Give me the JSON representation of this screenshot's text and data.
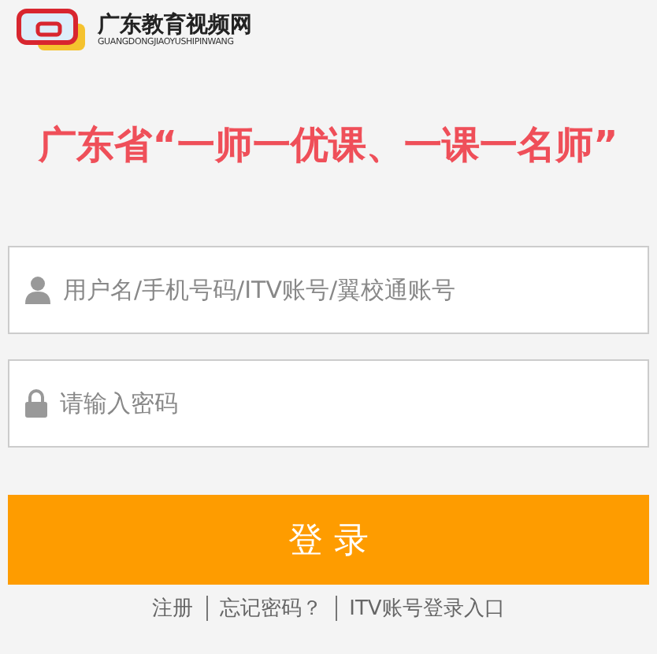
{
  "logo": {
    "name": "广东教育视频网",
    "subtitle": "GUANGDONGJIAOYUSHIPINWANG"
  },
  "headline": "广东省“一师一优课、一课一名师”",
  "fields": [
    {
      "kind": "user",
      "placeholder": "用户名/手机号码/ITV账号/翼校通账号"
    },
    {
      "kind": "password",
      "placeholder": "请输入密码"
    }
  ],
  "login_button": "登 录",
  "links": [
    "注册",
    "忘记密码？",
    "ITV账号登录入口"
  ]
}
